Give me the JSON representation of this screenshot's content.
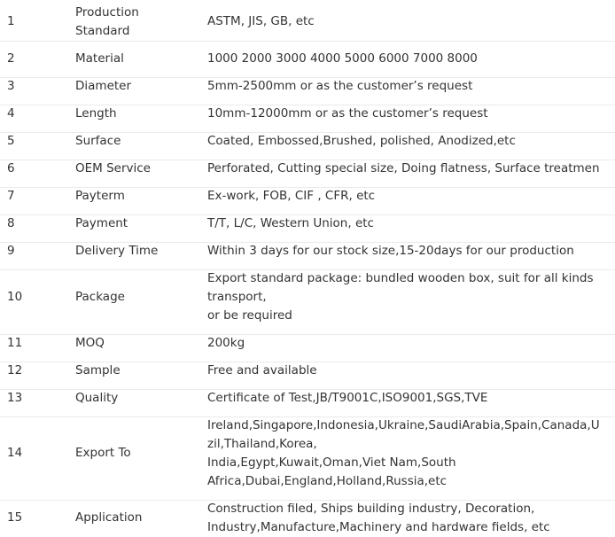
{
  "rows": [
    {
      "num": "1",
      "name_lines": [
        "Production",
        "Standard"
      ],
      "value_lines": [
        "ASTM, JIS, GB, etc"
      ]
    },
    {
      "num": "2",
      "name_lines": [
        "Material"
      ],
      "value_lines": [
        "1000 2000 3000 4000 5000 6000 7000 8000"
      ]
    },
    {
      "num": "3",
      "name_lines": [
        "Diameter"
      ],
      "value_lines": [
        "5mm-2500mm or as the customer’s request"
      ]
    },
    {
      "num": "4",
      "name_lines": [
        "Length"
      ],
      "value_lines": [
        "10mm-12000mm or as the customer’s request"
      ]
    },
    {
      "num": "5",
      "name_lines": [
        "Surface"
      ],
      "value_lines": [
        "Coated, Embossed,Brushed, polished, Anodized,etc"
      ]
    },
    {
      "num": "6",
      "name_lines": [
        "OEM Service"
      ],
      "value_lines": [
        "Perforated, Cutting special size, Doing flatness, Surface treatmen"
      ]
    },
    {
      "num": "7",
      "name_lines": [
        "Payterm"
      ],
      "value_lines": [
        "Ex-work, FOB, CIF , CFR, etc"
      ]
    },
    {
      "num": "8",
      "name_lines": [
        "Payment"
      ],
      "value_lines": [
        "T/T, L/C, Western Union, etc"
      ]
    },
    {
      "num": "9",
      "name_lines": [
        "Delivery Time"
      ],
      "value_lines": [
        "Within 3 days for our stock size,15-20days for our production"
      ]
    },
    {
      "num": "10",
      "name_lines": [
        "Package"
      ],
      "value_lines": [
        "Export standard package: bundled wooden box, suit for all kinds",
        "transport,",
        "or be required"
      ]
    },
    {
      "num": "11",
      "name_lines": [
        "MOQ"
      ],
      "value_lines": [
        "200kg"
      ]
    },
    {
      "num": "12",
      "name_lines": [
        "Sample"
      ],
      "value_lines": [
        "Free and available"
      ]
    },
    {
      "num": "13",
      "name_lines": [
        "Quality"
      ],
      "value_lines": [
        "Certificate of Test,JB/T9001C,ISO9001,SGS,TVE"
      ]
    },
    {
      "num": "14",
      "name_lines": [
        "Export To"
      ],
      "value_lines": [
        "Ireland,Singapore,Indonesia,Ukraine,SaudiArabia,Spain,Canada,U",
        "zil,Thailand,Korea,",
        "India,Egypt,Kuwait,Oman,Viet Nam,South",
        "Africa,Dubai,England,Holland,Russia,etc"
      ]
    },
    {
      "num": "15",
      "name_lines": [
        "Application"
      ],
      "value_lines": [
        "Construction filed, Ships building industry, Decoration,",
        "Industry,Manufacture,Machinery and hardware fields, etc"
      ]
    }
  ]
}
